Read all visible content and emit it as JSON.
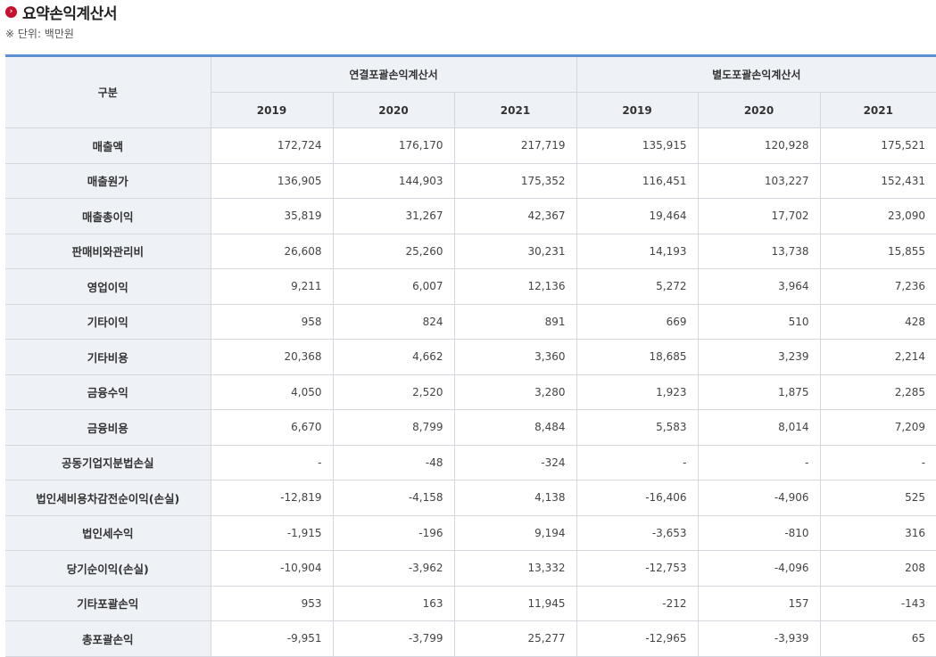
{
  "header": {
    "title": "요약손익계산서",
    "unit": "※ 단위: 백만원",
    "bullet_glyph": "›"
  },
  "table": {
    "row_header_label": "구분",
    "groups": [
      "연결포괄손익계산서",
      "별도포괄손익계산서"
    ],
    "years": [
      "2019",
      "2020",
      "2021",
      "2019",
      "2020",
      "2021"
    ],
    "rows": [
      {
        "label": "매출액",
        "values": [
          "172,724",
          "176,170",
          "217,719",
          "135,915",
          "120,928",
          "175,521"
        ]
      },
      {
        "label": "매출원가",
        "values": [
          "136,905",
          "144,903",
          "175,352",
          "116,451",
          "103,227",
          "152,431"
        ]
      },
      {
        "label": "매출총이익",
        "values": [
          "35,819",
          "31,267",
          "42,367",
          "19,464",
          "17,702",
          "23,090"
        ]
      },
      {
        "label": "판매비와관리비",
        "values": [
          "26,608",
          "25,260",
          "30,231",
          "14,193",
          "13,738",
          "15,855"
        ]
      },
      {
        "label": "영업이익",
        "values": [
          "9,211",
          "6,007",
          "12,136",
          "5,272",
          "3,964",
          "7,236"
        ]
      },
      {
        "label": "기타이익",
        "values": [
          "958",
          "824",
          "891",
          "669",
          "510",
          "428"
        ]
      },
      {
        "label": "기타비용",
        "values": [
          "20,368",
          "4,662",
          "3,360",
          "18,685",
          "3,239",
          "2,214"
        ]
      },
      {
        "label": "금융수익",
        "values": [
          "4,050",
          "2,520",
          "3,280",
          "1,923",
          "1,875",
          "2,285"
        ]
      },
      {
        "label": "금융비용",
        "values": [
          "6,670",
          "8,799",
          "8,484",
          "5,583",
          "8,014",
          "7,209"
        ]
      },
      {
        "label": "공동기업지분법손실",
        "values": [
          "-",
          "-48",
          "-324",
          "-",
          "-",
          "-"
        ]
      },
      {
        "label": "법인세비용차감전순이익(손실)",
        "values": [
          "-12,819",
          "-4,158",
          "4,138",
          "-16,406",
          "-4,906",
          "525"
        ]
      },
      {
        "label": "법인세수익",
        "values": [
          "-1,915",
          "-196",
          "9,194",
          "-3,653",
          "-810",
          "316"
        ]
      },
      {
        "label": "당기순이익(손실)",
        "values": [
          "-10,904",
          "-3,962",
          "13,332",
          "-12,753",
          "-4,096",
          "208"
        ]
      },
      {
        "label": "기타포괄손익",
        "values": [
          "953",
          "163",
          "11,945",
          "-212",
          "157",
          "-143"
        ]
      },
      {
        "label": "총포괄손익",
        "values": [
          "-9,951",
          "-3,799",
          "25,277",
          "-12,965",
          "-3,939",
          "65"
        ]
      }
    ]
  }
}
